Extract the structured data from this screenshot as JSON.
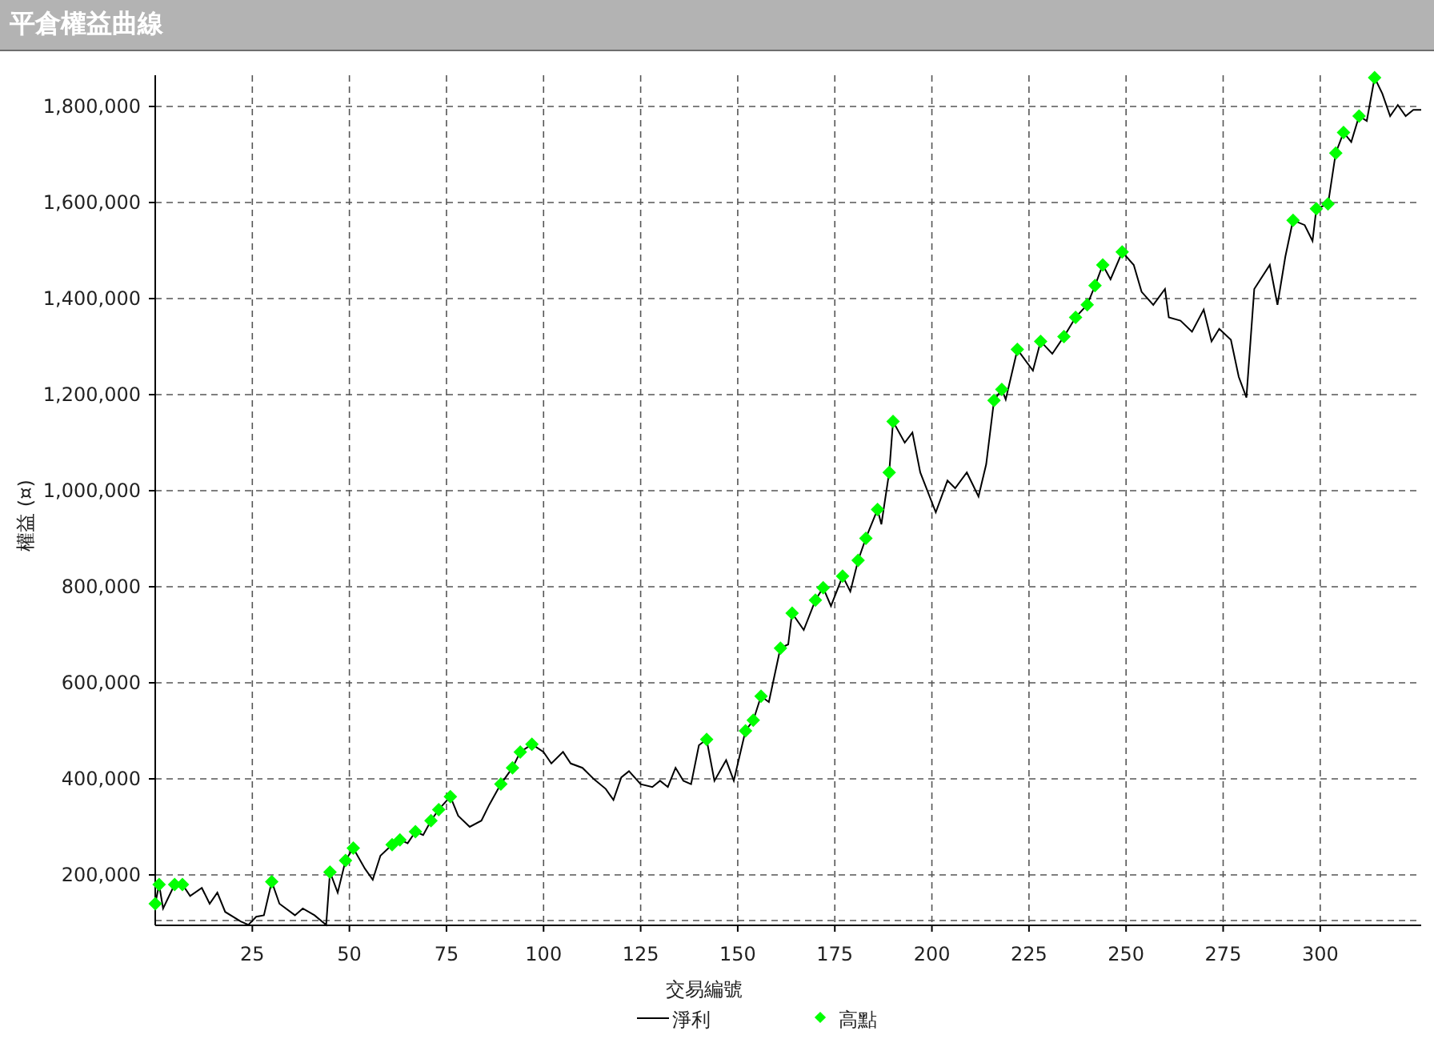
{
  "window": {
    "title": "平倉權益曲線"
  },
  "chart": {
    "chart_data": {
      "type": "line",
      "grid": true,
      "legend": "bottom",
      "xlabel": "交易編號",
      "ylabel": "權益 (¤)",
      "xlim": [
        0,
        326
      ],
      "ylim": [
        95000,
        1865000
      ],
      "xticks": [
        25,
        50,
        75,
        100,
        125,
        150,
        175,
        200,
        225,
        250,
        275,
        300
      ],
      "yticks": [
        {
          "value": 200000,
          "label": "200,000"
        },
        {
          "value": 400000,
          "label": "400,000"
        },
        {
          "value": 600000,
          "label": "600,000"
        },
        {
          "value": 800000,
          "label": "800,000"
        },
        {
          "value": 1000000,
          "label": "1,000,000"
        },
        {
          "value": 1200000,
          "label": "1,200,000"
        },
        {
          "value": 1400000,
          "label": "1,400,000"
        },
        {
          "value": 1600000,
          "label": "1,600,000"
        },
        {
          "value": 1800000,
          "label": "1,800,000"
        }
      ],
      "x": [
        0,
        1,
        2,
        5,
        7,
        9,
        12,
        14,
        16,
        18,
        22,
        24,
        26,
        28,
        30,
        32,
        36,
        38,
        41,
        44,
        45,
        47,
        49,
        51,
        54,
        56,
        58,
        61,
        63,
        65,
        67,
        69,
        71,
        73,
        76,
        78,
        81,
        84,
        86,
        89,
        92,
        94,
        97,
        100,
        102,
        105,
        107,
        110,
        113,
        116,
        118,
        120,
        122,
        125,
        128,
        130,
        132,
        134,
        136,
        138,
        140,
        142,
        144,
        147,
        149,
        152,
        154,
        156,
        158,
        161,
        163,
        164,
        167,
        170,
        172,
        174,
        177,
        179,
        181,
        183,
        186,
        187,
        189,
        190,
        193,
        195,
        197,
        201,
        204,
        206,
        209,
        212,
        214,
        216,
        218,
        219,
        222,
        226,
        228,
        231,
        234,
        237,
        240,
        242,
        244,
        246,
        249,
        252,
        254,
        257,
        260,
        261,
        264,
        267,
        270,
        272,
        274,
        277,
        279,
        281,
        283,
        287,
        289,
        291,
        293,
        296,
        298,
        299,
        302,
        304,
        306,
        308,
        310,
        312,
        314,
        316,
        318,
        320,
        322,
        324,
        326
      ],
      "series": [
        {
          "name": "淨利",
          "color": "#000000",
          "values": [
            140000,
            180000,
            130000,
            180000,
            180000,
            156000,
            173000,
            140000,
            163000,
            123000,
            103000,
            96000,
            113000,
            116000,
            186000,
            140000,
            116000,
            130000,
            116000,
            96000,
            206000,
            163000,
            230000,
            256000,
            213000,
            190000,
            240000,
            263000,
            273000,
            266000,
            290000,
            283000,
            313000,
            336000,
            363000,
            323000,
            300000,
            313000,
            346000,
            389000,
            423000,
            456000,
            472000,
            456000,
            432000,
            456000,
            432000,
            423000,
            399000,
            379000,
            356000,
            403000,
            416000,
            389000,
            383000,
            396000,
            383000,
            423000,
            396000,
            389000,
            470000,
            482000,
            396000,
            439000,
            396000,
            500000,
            522000,
            572000,
            560000,
            672000,
            680000,
            745000,
            710000,
            772000,
            798000,
            760000,
            822000,
            790000,
            855000,
            901000,
            961000,
            930000,
            1038000,
            1144000,
            1100000,
            1121000,
            1038000,
            955000,
            1021000,
            1005000,
            1038000,
            988000,
            1055000,
            1188000,
            1211000,
            1190000,
            1294000,
            1250000,
            1311000,
            1285000,
            1321000,
            1361000,
            1387000,
            1427000,
            1470000,
            1440000,
            1497000,
            1470000,
            1414000,
            1387000,
            1420000,
            1361000,
            1354000,
            1331000,
            1377000,
            1311000,
            1337000,
            1314000,
            1237000,
            1194000,
            1420000,
            1470000,
            1387000,
            1487000,
            1563000,
            1553000,
            1520000,
            1587000,
            1597000,
            1703000,
            1746000,
            1726000,
            1780000,
            1770000,
            1860000,
            1827000,
            1780000,
            1803000,
            1780000,
            1793000,
            1793000
          ]
        },
        {
          "name": "高點",
          "color": "#00ff00",
          "type": "scatter",
          "marker": "diamond",
          "values": [
            140000,
            180000,
            null,
            180000,
            180000,
            null,
            null,
            null,
            null,
            null,
            null,
            null,
            null,
            null,
            186000,
            null,
            null,
            null,
            null,
            null,
            206000,
            null,
            230000,
            256000,
            null,
            null,
            null,
            263000,
            273000,
            null,
            290000,
            null,
            313000,
            336000,
            363000,
            null,
            null,
            null,
            null,
            389000,
            423000,
            456000,
            472000,
            null,
            null,
            null,
            null,
            null,
            null,
            null,
            null,
            null,
            null,
            null,
            null,
            null,
            null,
            null,
            null,
            null,
            null,
            482000,
            null,
            null,
            null,
            500000,
            522000,
            572000,
            null,
            672000,
            null,
            745000,
            null,
            772000,
            798000,
            null,
            822000,
            null,
            855000,
            901000,
            961000,
            null,
            1038000,
            1144000,
            null,
            null,
            null,
            null,
            null,
            null,
            null,
            null,
            null,
            1188000,
            1211000,
            null,
            1294000,
            null,
            1311000,
            null,
            1321000,
            1361000,
            1387000,
            1427000,
            1470000,
            null,
            1497000,
            null,
            null,
            null,
            null,
            null,
            null,
            null,
            null,
            null,
            null,
            null,
            null,
            null,
            null,
            null,
            null,
            null,
            1563000,
            null,
            null,
            1587000,
            1597000,
            1703000,
            1746000,
            null,
            1780000,
            null,
            1860000,
            null,
            null,
            null,
            null,
            null,
            null
          ]
        }
      ]
    }
  }
}
